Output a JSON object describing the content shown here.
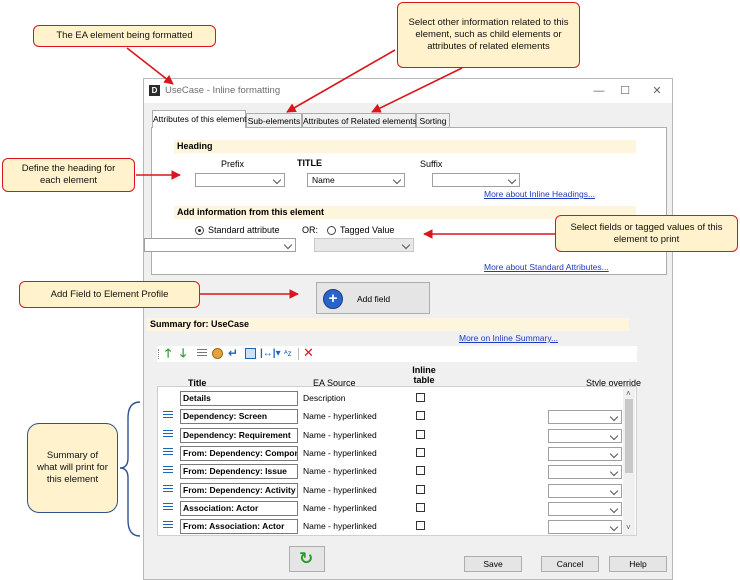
{
  "annotations": {
    "ea_element": "The EA element being formatted",
    "select_other": "Select other information related to this element, such as child elements or attributes of related elements",
    "define_heading": "Define the heading for each element",
    "select_fields": "Select fields or tagged values of this element to print",
    "add_field": "Add Field to Element Profile",
    "summary": "Summary of what will print for this element"
  },
  "window": {
    "icon_letter": "D",
    "title": "UseCase - Inline formatting",
    "minimize": "—",
    "maximize": "☐",
    "close": "✕"
  },
  "tabs": [
    {
      "label": "Attributes of this element",
      "active": true
    },
    {
      "label": "Sub-elements",
      "active": false
    },
    {
      "label": "Attributes of Related elements",
      "active": false
    },
    {
      "label": "Sorting",
      "active": false
    }
  ],
  "heading": {
    "section_title": "Heading",
    "prefix_label": "Prefix",
    "title_label": "TITLE",
    "suffix_label": "Suffix",
    "prefix_value": "",
    "title_value": "Name",
    "suffix_value": "",
    "more_link": "More about Inline Headings..."
  },
  "add_info": {
    "section_title": "Add information from this element",
    "standard_label": "Standard attribute",
    "or_label": "OR:",
    "tagged_label": "Tagged Value",
    "standard_selected": true,
    "standard_value": "",
    "tagged_value": "",
    "more_link": "More about Standard Attributes..."
  },
  "add_field_button": "Add field",
  "summary": {
    "title": "Summary for: UseCase",
    "more_link": "More on Inline Summary...",
    "columns": {
      "title": "Title",
      "source": "EA Source",
      "inline": "Inline table",
      "style": "Style override"
    },
    "rows": [
      {
        "title": "Details",
        "source": "Description",
        "has_icon": false,
        "has_style": false
      },
      {
        "title": "Dependency: Screen",
        "source": "Name - hyperlinked",
        "has_icon": true,
        "has_style": true
      },
      {
        "title": "Dependency: Requirement",
        "source": "Name - hyperlinked",
        "has_icon": true,
        "has_style": true
      },
      {
        "title": "From: Dependency: Component",
        "source": "Name - hyperlinked",
        "has_icon": true,
        "has_style": true
      },
      {
        "title": "From: Dependency: Issue",
        "source": "Name - hyperlinked",
        "has_icon": true,
        "has_style": true
      },
      {
        "title": "From: Dependency: Activity",
        "source": "Name - hyperlinked",
        "has_icon": true,
        "has_style": true
      },
      {
        "title": "Association: Actor",
        "source": "Name - hyperlinked",
        "has_icon": true,
        "has_style": true
      },
      {
        "title": "From: Association: Actor",
        "source": "Name - hyperlinked",
        "has_icon": true,
        "has_style": true
      }
    ]
  },
  "toolbar_icons": [
    "move-up-icon",
    "move-down-icon",
    "list-icon",
    "palette-icon",
    "line-break-icon",
    "layout-icon",
    "width-icon",
    "sort-az-icon",
    "delete-icon"
  ],
  "buttons": {
    "save": "Save",
    "cancel": "Cancel",
    "help": "Help"
  },
  "colors": {
    "callout_fill": "#fff2cc",
    "callout_border": "#d9161c",
    "summary_border": "#2f528f",
    "section_band": "#fdf5dc",
    "link": "#1d3bbf"
  }
}
